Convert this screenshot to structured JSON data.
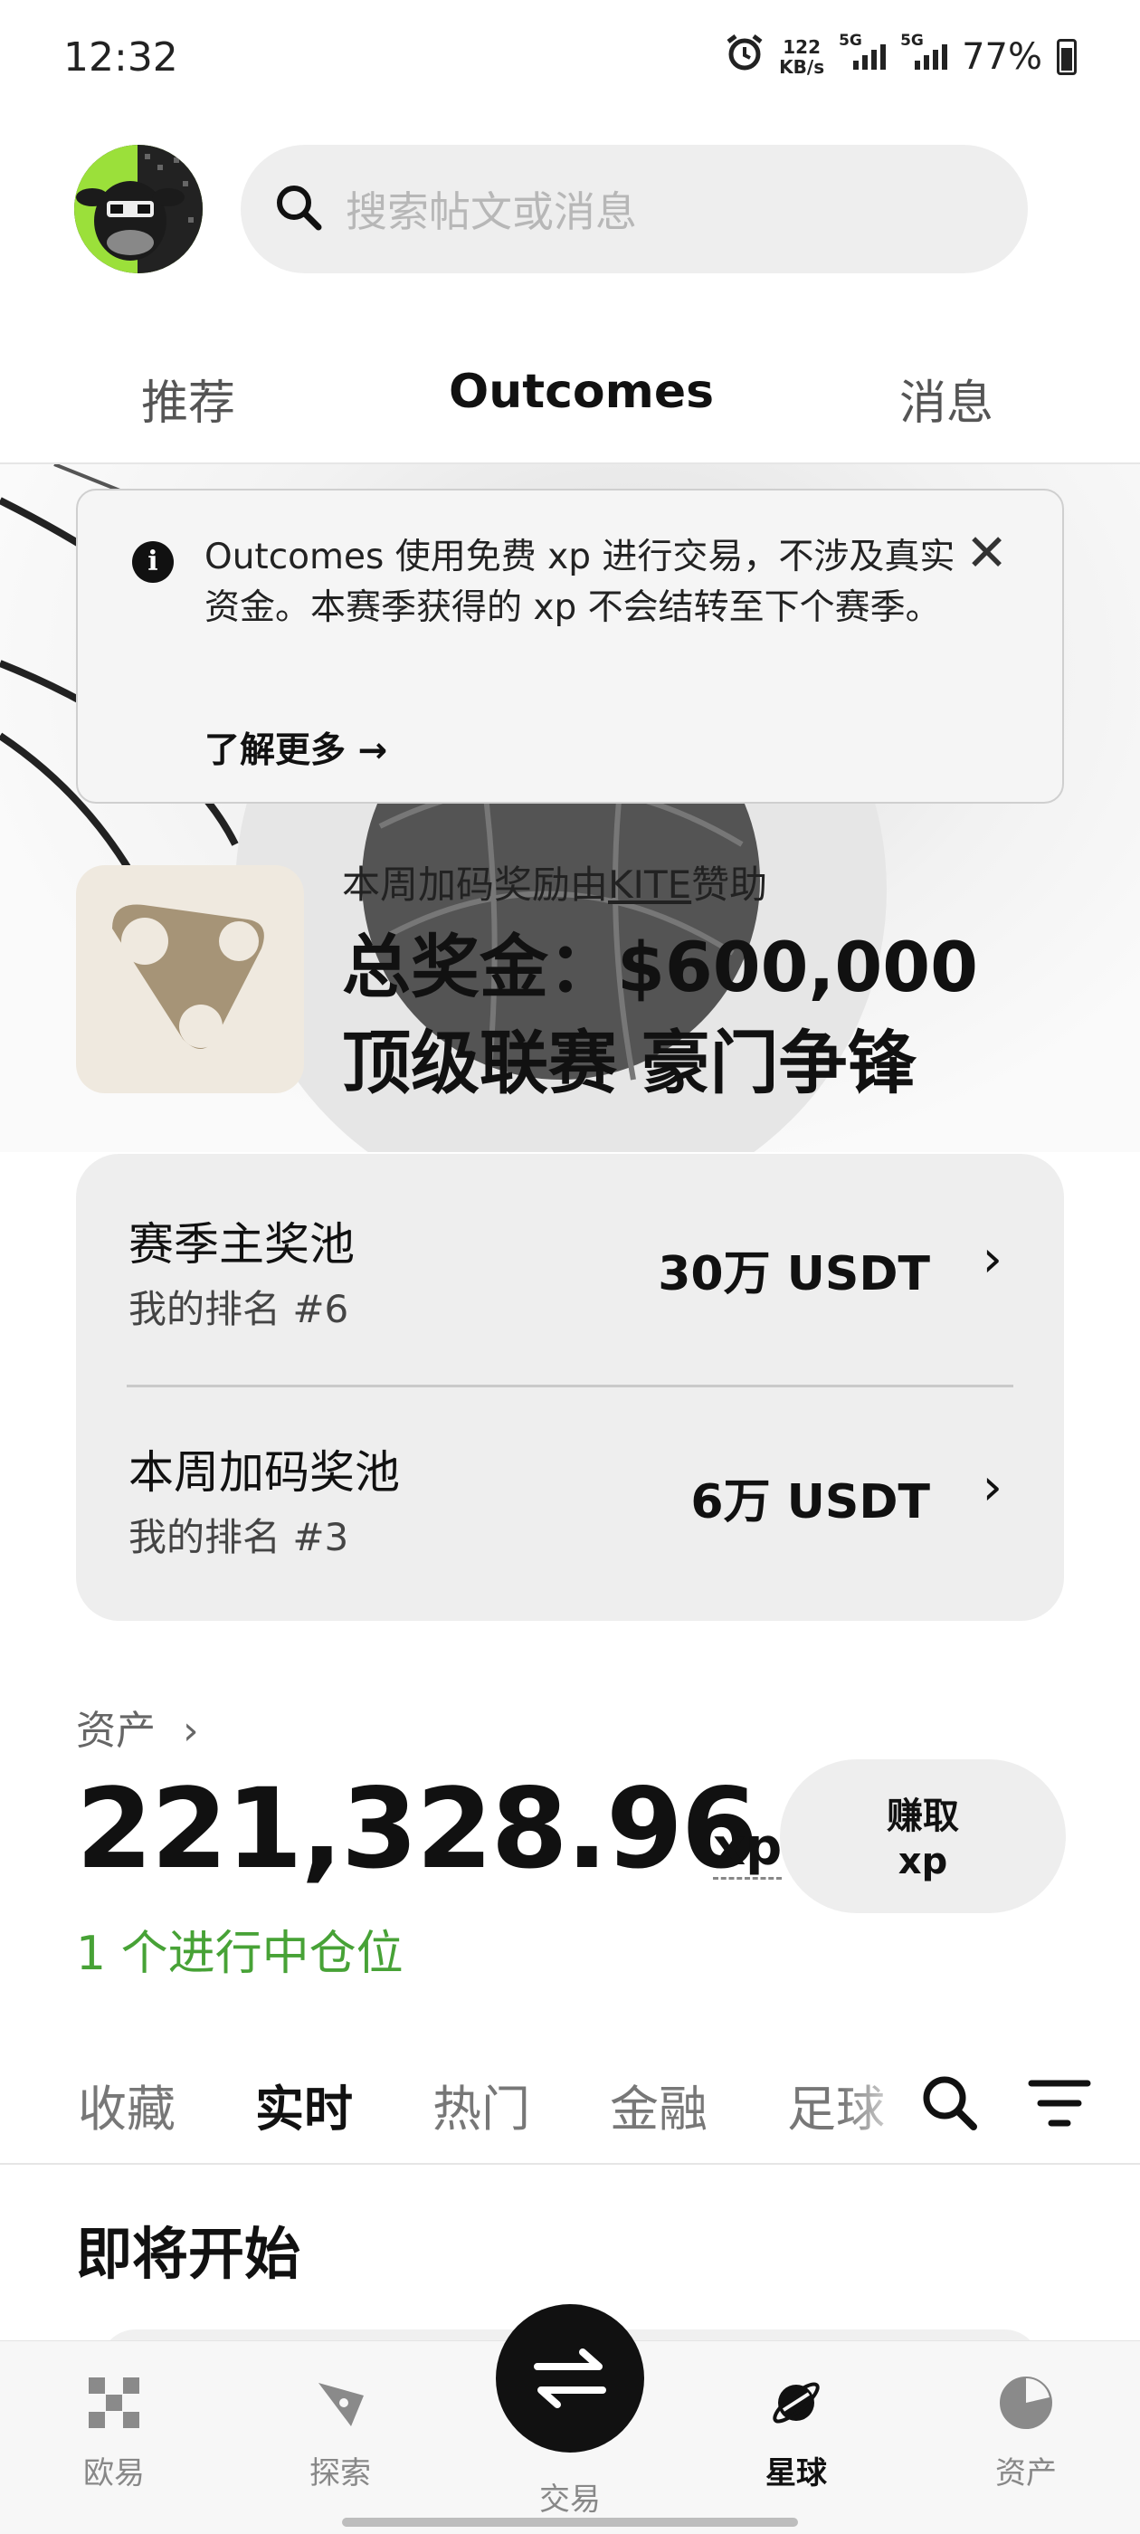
{
  "status_bar": {
    "time": "12:32",
    "net_speed_value": "122",
    "net_speed_unit": "KB/s",
    "sig1_label": "5G",
    "sig2_label": "5G",
    "battery": "77%"
  },
  "search": {
    "placeholder": "搜索帖文或消息"
  },
  "top_tabs": [
    {
      "label": "推荐"
    },
    {
      "label": "Outcomes"
    },
    {
      "label": "消息"
    }
  ],
  "notice": {
    "text": "Outcomes 使用免费 xp 进行交易，不涉及真实资金。本赛季获得的 xp 不会结转至下个赛季。",
    "more": "了解更多 →"
  },
  "hero": {
    "sponsor_prefix": "本周加码奖励由",
    "sponsor_name": "KITE",
    "sponsor_suffix": "赞助",
    "title_line1": "总奖金：$600,000",
    "title_line2": "顶级联赛 豪门争锋"
  },
  "pools": [
    {
      "name": "赛季主奖池",
      "rank": "我的排名 #6",
      "amount": "30万 USDT"
    },
    {
      "name": "本周加码奖池",
      "rank": "我的排名 #3",
      "amount": "6万 USDT"
    }
  ],
  "assets": {
    "label": "资产",
    "value": "221,328.96",
    "unit": "xp",
    "earn_line1": "赚取",
    "earn_line2": "xp",
    "positions": "1 个进行中仓位"
  },
  "category_tabs": [
    "收藏",
    "实时",
    "热门",
    "金融",
    "足球"
  ],
  "section_title": "即将开始",
  "bottom_nav": [
    {
      "label": "欧易"
    },
    {
      "label": "探索"
    },
    {
      "label": "交易"
    },
    {
      "label": "星球"
    },
    {
      "label": "资产"
    }
  ],
  "colors": {
    "accent_green": "#47a236",
    "card_bg": "#eeeeee"
  }
}
